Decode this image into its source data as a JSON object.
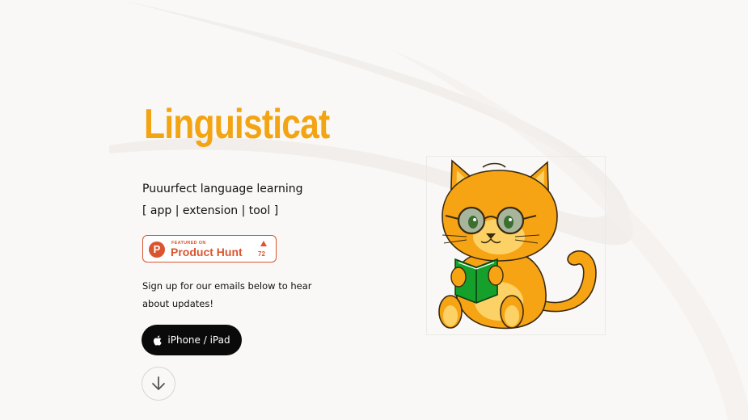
{
  "brand": {
    "logo_text": "Linguisticat",
    "accent_color": "#f2a413"
  },
  "hero": {
    "tagline": "Puuurfect language learning",
    "modes": "[ app | extension | tool ]",
    "signup_text": "Sign up for our emails below to hear about updates!"
  },
  "product_hunt": {
    "featured_label": "FEATURED ON",
    "name": "Product Hunt",
    "logo_letter": "P",
    "upvotes": "72",
    "color": "#da552f"
  },
  "actions": {
    "ios_label": "iPhone / iPad",
    "ios_icon": "apple-icon",
    "scroll_icon": "arrow-down-icon"
  },
  "illustration": {
    "name": "cat-reading-book-illustration"
  }
}
